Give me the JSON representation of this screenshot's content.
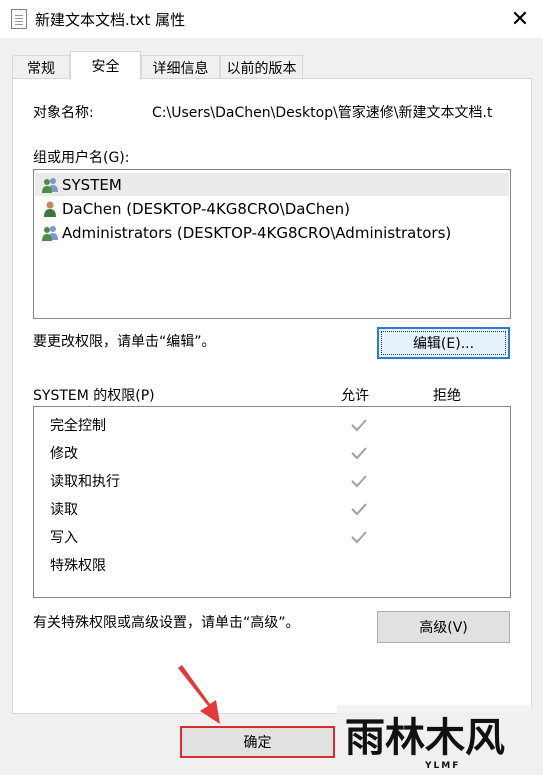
{
  "window": {
    "title": "新建文本文档.txt 属性",
    "close_symbol": "✕"
  },
  "tabs": [
    {
      "label": "常规",
      "active": false
    },
    {
      "label": "安全",
      "active": true
    },
    {
      "label": "详细信息",
      "active": false
    },
    {
      "label": "以前的版本",
      "active": false
    }
  ],
  "object": {
    "label": "对象名称:",
    "value": "C:\\Users\\DaChen\\Desktop\\管家速修\\新建文本文档.t"
  },
  "groups": {
    "label": "组或用户名(G):",
    "items": [
      {
        "name": "SYSTEM",
        "icon": "group-users-icon",
        "selected": true
      },
      {
        "name": "DaChen (DESKTOP-4KG8CRO\\DaChen)",
        "icon": "single-user-icon",
        "selected": false
      },
      {
        "name": "Administrators (DESKTOP-4KG8CRO\\Administrators)",
        "icon": "group-users-icon",
        "selected": false
      }
    ]
  },
  "edit": {
    "hint": "要更改权限，请单击“编辑”。",
    "button_label": "编辑(E)..."
  },
  "permissions": {
    "label": "SYSTEM 的权限(P)",
    "allow_header": "允许",
    "deny_header": "拒绝",
    "rows": [
      {
        "name": "完全控制",
        "allow": true,
        "deny": false
      },
      {
        "name": "修改",
        "allow": true,
        "deny": false
      },
      {
        "name": "读取和执行",
        "allow": true,
        "deny": false
      },
      {
        "name": "读取",
        "allow": true,
        "deny": false
      },
      {
        "name": "写入",
        "allow": true,
        "deny": false
      },
      {
        "name": "特殊权限",
        "allow": false,
        "deny": false
      }
    ]
  },
  "advanced": {
    "hint": "有关特殊权限或高级设置，请单击“高级”。",
    "button_label": "高级(V)"
  },
  "footer": {
    "ok_label": "确定"
  },
  "watermark": {
    "text": "雨林木风",
    "sub": "YLMF"
  },
  "colors": {
    "highlight_red": "#d92d2d",
    "focus_blue": "#2b7bd5",
    "check_gray": "#a0a0a0"
  }
}
